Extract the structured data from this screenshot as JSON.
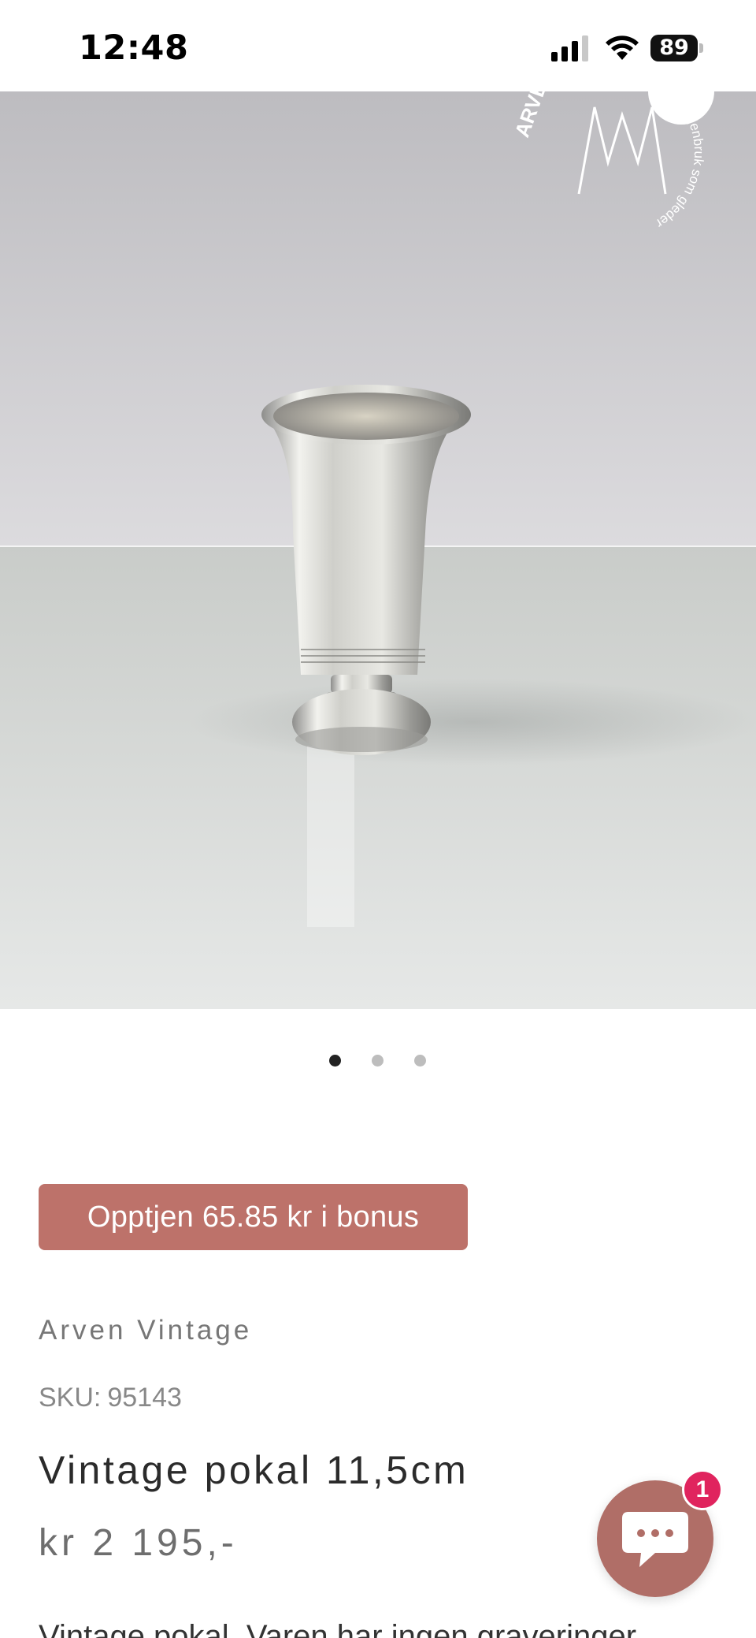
{
  "status_bar": {
    "time": "12:48",
    "battery": "89"
  },
  "hero": {
    "brand_logo": {
      "text_top": "ARVEN",
      "text_ring": "gjenbruk som gleder",
      "icon": "crown-logo-icon"
    }
  },
  "carousel": {
    "count": 3,
    "active_index": 0
  },
  "bonus": {
    "label": "Opptjen 65.85 kr i bonus"
  },
  "product": {
    "vendor": "Arven Vintage",
    "sku_label": "SKU:",
    "sku_value": "95143",
    "title": "Vintage pokal 11,5cm",
    "price": "kr 2 195,-",
    "description": "Vintage pokal. Varen har ingen graveringer."
  },
  "chat": {
    "icon": "chat-bubble-icon",
    "badge": "1"
  },
  "colors": {
    "accent": "#bd726a",
    "chat": "#b06e67",
    "badge": "#e0245e"
  }
}
